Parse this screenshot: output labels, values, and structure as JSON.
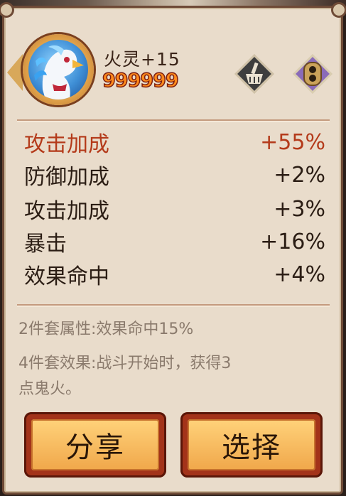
{
  "header": {
    "name": "火灵+15",
    "score": "999999"
  },
  "stats": [
    {
      "label": "攻击加成",
      "value": "+55%",
      "highlight": true
    },
    {
      "label": "防御加成",
      "value": "+2%",
      "highlight": false
    },
    {
      "label": "攻击加成",
      "value": "+3%",
      "highlight": false
    },
    {
      "label": "暴击",
      "value": "+16%",
      "highlight": false
    },
    {
      "label": "效果命中",
      "value": "+4%",
      "highlight": false
    }
  ],
  "set_bonus": {
    "two_piece": "2件套属性:效果命中15%",
    "four_piece_line1": "4件套效果:战斗开始时，获得3",
    "four_piece_line2": "点鬼火。"
  },
  "buttons": {
    "share": "分享",
    "select": "选择"
  },
  "icons": {
    "broom": "broom-icon",
    "lock": "lock-icon"
  },
  "colors": {
    "highlight": "#b43a1a",
    "score": "#ff8a1c",
    "panel": "#e9dccb"
  }
}
